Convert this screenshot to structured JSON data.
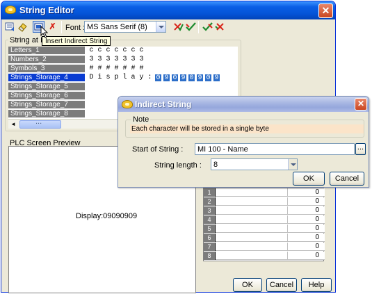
{
  "main_window": {
    "title": "String Editor",
    "close_glyph": "✕",
    "toolbar": {
      "icons": [
        "open-icon",
        "eraser-icon",
        "insert-indirect-string-icon",
        "delete-icon",
        "font-red-check-icon",
        "font-green-check-icon",
        "accept-green-icon",
        "accept-red-icon"
      ],
      "delete_glyph": "✗",
      "font_label": "Font :",
      "font_value": "MS Sans Serif (8)"
    },
    "tooltip": "Insert Indirect String",
    "string_group_label": "String at ID",
    "rows": [
      {
        "label": "Letters_1",
        "chars": [
          "c",
          "c",
          "c",
          "c",
          "c",
          "c",
          "c"
        ]
      },
      {
        "label": "Numbers_2",
        "chars": [
          "3",
          "3",
          "3",
          "3",
          "3",
          "3",
          "3"
        ]
      },
      {
        "label": "Symbols_3",
        "chars": [
          "#",
          "#",
          "#",
          "#",
          "#",
          "#",
          "#"
        ]
      },
      {
        "label": "Strings_Storage_4",
        "chars": [
          "D",
          "i",
          "s",
          "p",
          "l",
          "a",
          "y",
          ":"
        ],
        "highlight_chars": [
          "0",
          "9",
          "0",
          "9",
          "0",
          "9",
          "0",
          "9"
        ]
      },
      {
        "label": "Strings_Storage_5",
        "chars": []
      },
      {
        "label": "Strings_Storage_6",
        "chars": []
      },
      {
        "label": "Strings_Storage_7",
        "chars": []
      },
      {
        "label": "Strings_Storage_8",
        "chars": []
      }
    ],
    "selected_row": 3,
    "scroll_left_glyph": "◄",
    "preview": {
      "label": "PLC Screen Preview",
      "text": "Display:09090909"
    },
    "bottom_table": [
      {
        "index": "1",
        "value": "0"
      },
      {
        "index": "2",
        "value": "0"
      },
      {
        "index": "3",
        "value": "0"
      },
      {
        "index": "4",
        "value": "0"
      },
      {
        "index": "5",
        "value": "0"
      },
      {
        "index": "6",
        "value": "0"
      },
      {
        "index": "7",
        "value": "0"
      },
      {
        "index": "8",
        "value": "0"
      }
    ],
    "buttons": {
      "ok": "OK",
      "cancel": "Cancel",
      "help": "Help"
    }
  },
  "indirect_dialog": {
    "title": "Indirect String",
    "close_glyph": "✕",
    "note_label": "Note",
    "note_text": "Each character will be stored in a single byte",
    "start_label": "Start of String :",
    "start_value": "MI 100  - Name",
    "browse_label": "...",
    "length_label": "String length :",
    "length_value": "8",
    "buttons": {
      "ok": "OK",
      "cancel": "Cancel"
    }
  },
  "colors": {
    "title_blue": "#0453d6",
    "selected_row": "#0a3cd2",
    "highlight_cell": "#2c6ec9",
    "row_header_gray": "#7c7c7c",
    "note_bg": "#fbe4c9"
  }
}
